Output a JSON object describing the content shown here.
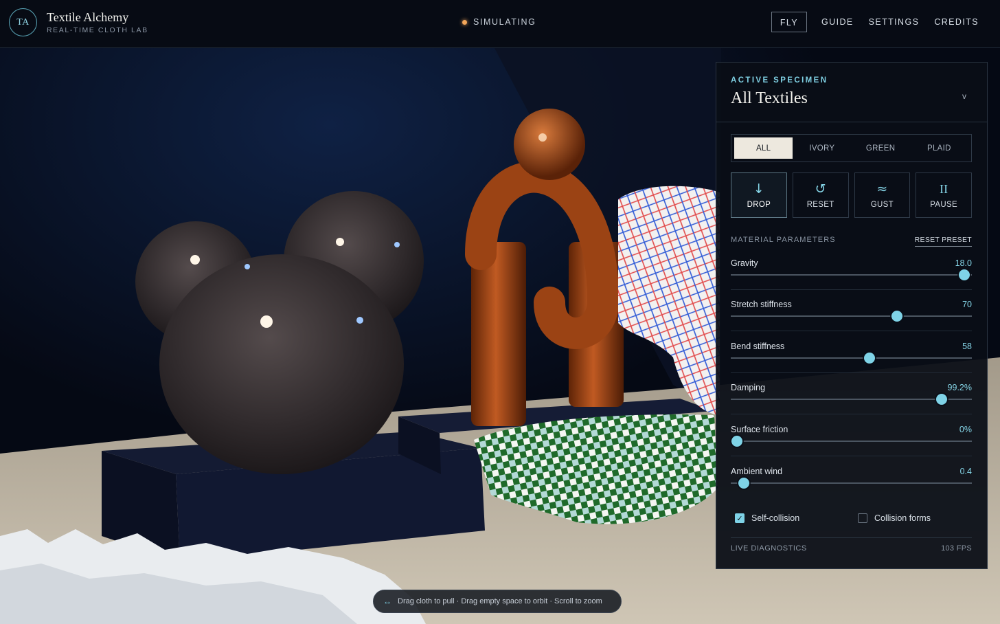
{
  "header": {
    "logo_text": "TA",
    "title": "Textile Alchemy",
    "subtitle": "REAL-TIME CLOTH LAB",
    "status": "SIMULATING",
    "nav": [
      "FLY",
      "GUIDE",
      "SETTINGS",
      "CREDITS"
    ],
    "active_nav": "FLY"
  },
  "panel": {
    "kicker": "ACTIVE SPECIMEN",
    "title": "All Textiles",
    "dropdown_glyph": "v",
    "tabs": [
      "ALL",
      "IVORY",
      "GREEN",
      "PLAID"
    ],
    "active_tab": "ALL",
    "actions": [
      {
        "label": "DROP",
        "icon": "down-arrow-icon",
        "glyph": "↓"
      },
      {
        "label": "RESET",
        "icon": "reset-icon",
        "glyph": "↺"
      },
      {
        "label": "GUST",
        "icon": "wind-icon",
        "glyph": "≈"
      },
      {
        "label": "PAUSE",
        "icon": "pause-icon",
        "glyph": "II"
      }
    ],
    "active_action": "DROP",
    "params_title": "MATERIAL PARAMETERS",
    "reset_preset": "RESET PRESET",
    "params": [
      {
        "name": "Gravity",
        "value": "18.0",
        "level": 0.97
      },
      {
        "name": "Stretch stiffness",
        "value": "70",
        "level": 0.69
      },
      {
        "name": "Bend stiffness",
        "value": "58",
        "level": 0.575
      },
      {
        "name": "Damping",
        "value": "99.2%",
        "level": 0.875
      },
      {
        "name": "Surface friction",
        "value": "0%",
        "level": 0.025
      },
      {
        "name": "Ambient wind",
        "value": "0.4",
        "level": 0.055
      }
    ],
    "checks": [
      {
        "label": "Self-collision",
        "checked": true
      },
      {
        "label": "Collision forms",
        "checked": false
      }
    ],
    "diagnostics_label": "LIVE DIAGNOSTICS",
    "fps": "103 FPS"
  },
  "hint": {
    "icon": "drag-arrows-icon",
    "glyph": "↔",
    "text": "Drag cloth to pull · Drag empty space to orbit · Scroll to zoom"
  },
  "colors": {
    "accent": "#7fd3e7",
    "status_dot": "#f2a65a",
    "panel_bg": "#0a0e16",
    "active_tab_bg": "#ede8de"
  }
}
